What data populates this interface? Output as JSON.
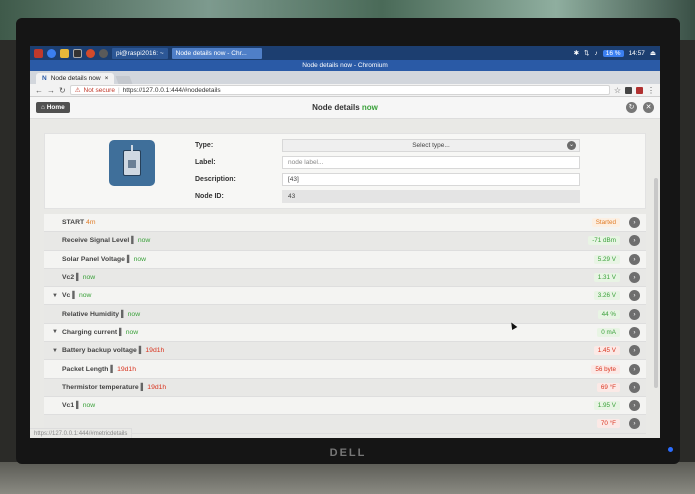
{
  "taskbar": {
    "task_terminal": "pi@raspi2016: ~",
    "task_browser": "Node details now - Chr...",
    "badge": "16 %",
    "clock": "14:57"
  },
  "window": {
    "title": "Node details now - Chromium"
  },
  "browser": {
    "tab_title": "Node details now",
    "tab_close": "×",
    "not_secure": "Not secure",
    "url": "https://127.0.0.1:444/#nodedetails",
    "status_url": "https://127.0.0.1:444/#metricdetails"
  },
  "app": {
    "home_label": "Home",
    "title_main": "Node details",
    "title_suffix": "now"
  },
  "node": {
    "type_label": "Type:",
    "type_value": "Select type...",
    "label_label": "Label:",
    "label_placeholder": "node label...",
    "description_label": "Description:",
    "description_value": "[43]",
    "nodeid_label": "Node ID:",
    "nodeid_value": "43"
  },
  "metrics": [
    {
      "name": "START",
      "signal_icon": "",
      "age": "4m",
      "age_color": "orange",
      "value": "Started",
      "value_color": "orange",
      "expandable": false
    },
    {
      "name": "Receive Signal Level",
      "signal_icon": "▌",
      "age": "now",
      "age_color": "green",
      "value": "-71 dBm",
      "value_color": "green",
      "expandable": false
    },
    {
      "name": "Solar Panel Voltage",
      "signal_icon": "▌",
      "age": "now",
      "age_color": "green",
      "value": "5.29 V",
      "value_color": "green",
      "expandable": false
    },
    {
      "name": "Vc2",
      "signal_icon": "▌",
      "age": "now",
      "age_color": "green",
      "value": "1.31 V",
      "value_color": "green",
      "expandable": false
    },
    {
      "name": "Vc",
      "signal_icon": "▌",
      "age": "now",
      "age_color": "green",
      "value": "3.26 V",
      "value_color": "green",
      "expandable": true
    },
    {
      "name": "Relative Humidity",
      "signal_icon": "▌",
      "age": "now",
      "age_color": "green",
      "value": "44 %",
      "value_color": "green",
      "expandable": false
    },
    {
      "name": "Charging current",
      "signal_icon": "▌",
      "age": "now",
      "age_color": "green",
      "value": "0 mA",
      "value_color": "green",
      "expandable": true
    },
    {
      "name": "Battery backup voltage",
      "signal_icon": "▌",
      "age": "19d1h",
      "age_color": "red",
      "value": "1.45 V",
      "value_color": "red",
      "expandable": true
    },
    {
      "name": "Packet Length",
      "signal_icon": "▌",
      "age": "19d1h",
      "age_color": "red",
      "value": "56 byte",
      "value_color": "red",
      "expandable": false
    },
    {
      "name": "Thermistor temperature",
      "signal_icon": "▌",
      "age": "19d1h",
      "age_color": "red",
      "value": "69 °F",
      "value_color": "red",
      "expandable": false
    },
    {
      "name": "Vc1",
      "signal_icon": "▌",
      "age": "now",
      "age_color": "green",
      "value": "1.95 V",
      "value_color": "green",
      "expandable": false
    },
    {
      "name": "",
      "signal_icon": "",
      "age": "",
      "age_color": "red",
      "value": "70 °F",
      "value_color": "red",
      "expandable": false
    }
  ],
  "monitor": {
    "brand": "DELL"
  }
}
